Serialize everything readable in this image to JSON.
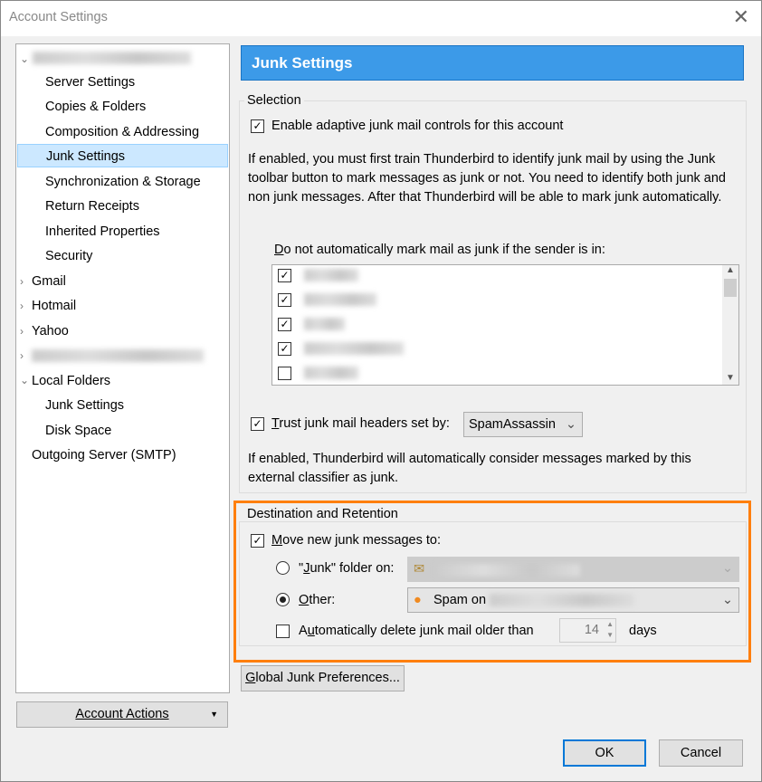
{
  "window": {
    "title": "Account Settings",
    "close": "✕"
  },
  "tree": {
    "items": [
      {
        "label": "Server Settings"
      },
      {
        "label": "Copies & Folders"
      },
      {
        "label": "Composition & Addressing"
      },
      {
        "label": "Junk Settings"
      },
      {
        "label": "Synchronization & Storage"
      },
      {
        "label": "Return Receipts"
      },
      {
        "label": "Inherited Properties"
      },
      {
        "label": "Security"
      }
    ],
    "accounts": [
      "Gmail",
      "Hotmail",
      "Yahoo"
    ],
    "local_folders": "Local Folders",
    "local_items": [
      "Junk Settings",
      "Disk Space"
    ],
    "outgoing": "Outgoing Server (SMTP)"
  },
  "account_actions": "Account Actions",
  "header": "Junk Settings",
  "selection": {
    "legend": "Selection",
    "enable_label": "Enable adaptive junk mail controls for this account",
    "enable_checked": true,
    "description": "If enabled, you must first train Thunderbird to identify junk mail by using the Junk toolbar button to mark messages as junk or not. You need to identify both junk and non junk messages. After that Thunderbird will be able to mark junk automatically.",
    "whitelist_label_first": "D",
    "whitelist_label_rest": "o not automatically mark mail as junk if the sender is in:",
    "whitelist_checked": [
      true,
      true,
      true,
      true,
      false
    ],
    "trust_label_first": "T",
    "trust_label_rest": "rust junk mail headers set by:",
    "trust_checked": true,
    "trust_value": "SpamAssassin",
    "trust_description": "If enabled, Thunderbird will automatically consider messages marked by this external classifier as junk."
  },
  "destination": {
    "legend": "Destination and Retention",
    "move_first": "M",
    "move_rest": "ove new junk messages to:",
    "move_checked": true,
    "junk_pre": "\"",
    "junk_u": "J",
    "junk_rest": "unk\" folder on:",
    "other_u": "O",
    "other_rest": "ther:",
    "other_value": "Spam on",
    "delete_pre": "A",
    "delete_u": "u",
    "delete_rest": "tomatically delete junk mail older than",
    "delete_checked": false,
    "days_value": "14",
    "days_label": "days"
  },
  "global_prefs_first": "G",
  "global_prefs_rest": "lobal Junk Preferences...",
  "ok": "OK",
  "cancel": "Cancel",
  "colors": {
    "header": "#3c9ae8",
    "highlight": "#ff7f0e",
    "selection": "#cce8ff"
  }
}
